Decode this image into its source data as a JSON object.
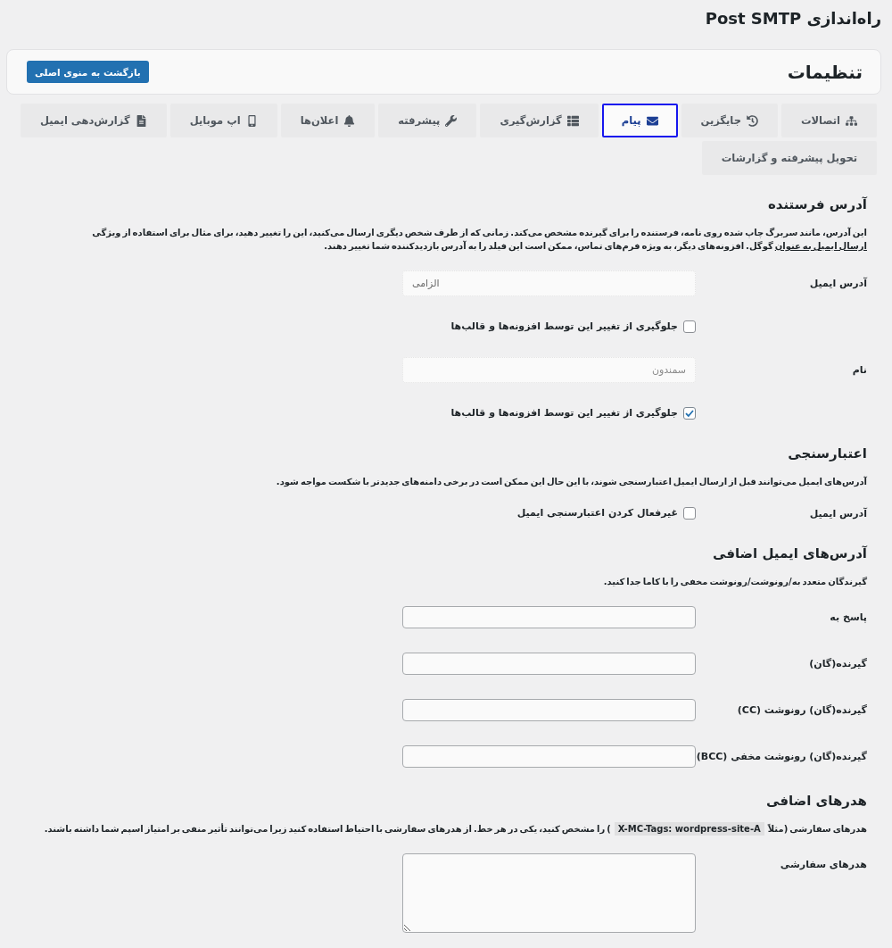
{
  "page_title": "راه‌اندازی Post SMTP",
  "settings_panel": {
    "title": "تنظیمات",
    "back_button": "بازگشت به منوی اصلی"
  },
  "tabs": [
    {
      "label": "اتصالات",
      "selected": false
    },
    {
      "label": "جایگزین",
      "selected": false
    },
    {
      "label": "پیام",
      "selected": true
    },
    {
      "label": "گزارش‌گیری",
      "selected": false
    },
    {
      "label": "پیشرفته",
      "selected": false
    },
    {
      "label": "اعلان‌ها",
      "selected": false
    },
    {
      "label": "اپ موبایل",
      "selected": false
    },
    {
      "label": "گزارش‌دهی ایمیل",
      "selected": false
    },
    {
      "label": "تحویل پیشرفته و گزارشات",
      "selected": false
    }
  ],
  "sections": [
    {
      "heading": "آدرس فرستنده",
      "description": {
        "before": "این آدرس، مانند سربرگ چاپ شده روی نامه، فرستنده را برای گیرنده مشخص می‌کند. زمانی که از طرف شخص دیگری ارسال می‌کنید، این را تغییر دهید، برای مثال برای استفاده از ویژگی ",
        "link": "ارسال ایمیل به عنوان",
        "after": " گوگل. افزونه‌های دیگر، به ویژه فرم‌های تماس، ممکن است این فیلد را به آدرس بازدیدکننده شما تغییر دهند."
      },
      "rows": [
        {
          "kind": "email",
          "label": "آدرس ایمیل",
          "placeholder": "الزامی",
          "disabled": true
        },
        {
          "kind": "checkbox",
          "text": "جلوگیری از تغییر این توسط افزونه‌ها و قالب‌ها",
          "checked": false
        },
        {
          "kind": "text",
          "label": "نام",
          "value": "سمندون",
          "disabled": true
        },
        {
          "kind": "checkbox",
          "text": "جلوگیری از تغییر این توسط افزونه‌ها و قالب‌ها",
          "checked": true
        }
      ]
    },
    {
      "heading": "اعتبارسنجی",
      "description": {
        "before": "آدرس‌های ایمیل می‌توانند قبل از ارسال ایمیل اعتبارسنجی شوند، با این حال این ممکن است در برخی دامنه‌های جدیدتر با شکست مواجه شود."
      },
      "rows": [
        {
          "kind": "checkbox",
          "label": "آدرس ایمیل",
          "text": "غیرفعال کردن اعتبارسنجی ایمیل",
          "checked": false
        }
      ]
    },
    {
      "heading": "آدرس‌های ایمیل اضافی",
      "description": {
        "before": "گیرندگان متعدد به/رونوشت/رونوشت مخفی را با کاما جدا کنید."
      },
      "rows": [
        {
          "kind": "text",
          "label": "پاسخ به",
          "disabled": false
        },
        {
          "kind": "text",
          "label": "گیرنده(گان)",
          "disabled": false
        },
        {
          "kind": "text",
          "label": "گیرنده(گان) رونوشت (CC)",
          "disabled": false
        },
        {
          "kind": "text",
          "label": "گیرنده(گان) رونوشت مخفی (BCC)",
          "disabled": false
        }
      ]
    },
    {
      "heading": "هدرهای اضافی",
      "description": {
        "before": "هدرهای سفارشی (مثلاً ",
        "code": "X-MC-Tags: wordpress-site-A",
        "after": " ) را مشخص کنید، یکی در هر خط. از هدرهای سفارشی با احتیاط استفاده کنید زیرا می‌توانند تأثیر منفی بر امتیاز اسپم شما داشته باشند."
      },
      "rows": [
        {
          "kind": "textarea",
          "label": "هدرهای سفارشی"
        }
      ]
    }
  ]
}
